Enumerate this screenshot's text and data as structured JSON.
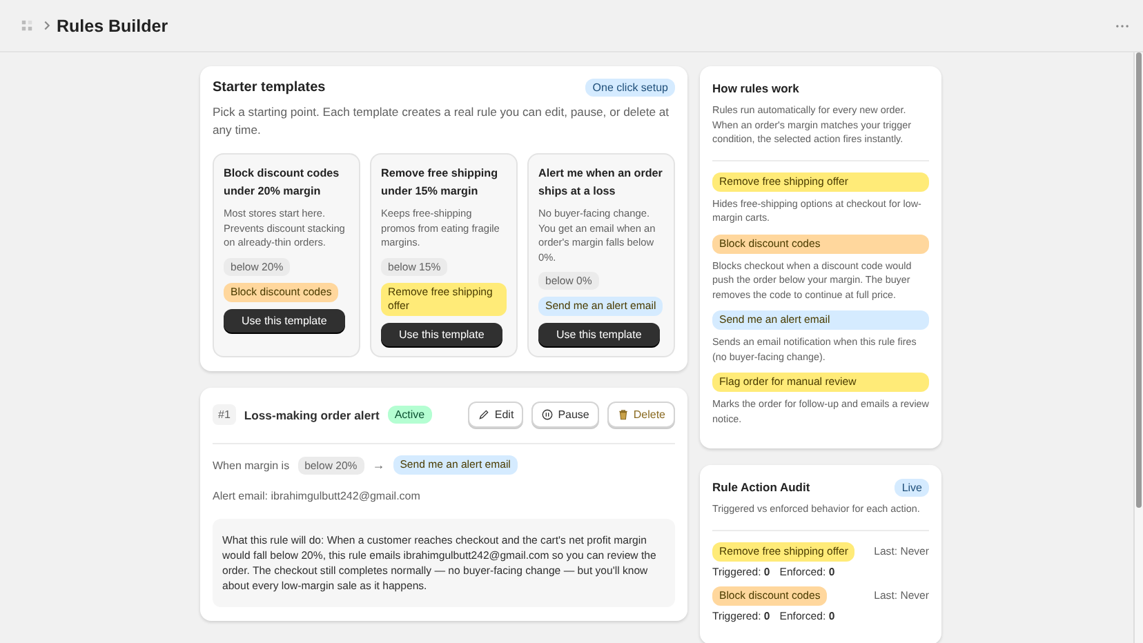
{
  "header": {
    "title": "Rules Builder"
  },
  "starter": {
    "title": "Starter templates",
    "badge": "One click setup",
    "description": "Pick a starting point. Each template creates a real rule you can edit, pause, or delete at any time.",
    "templates": [
      {
        "title": "Block discount codes under 20% margin",
        "description": "Most stores start here. Prevents discount stacking on already-thin orders.",
        "condition": "below 20%",
        "action": {
          "text": "Block discount codes",
          "color": "#ffd79d"
        },
        "button": "Use this template"
      },
      {
        "title": "Remove free shipping under 15% margin",
        "description": "Keeps free-shipping promos from eating fragile margins.",
        "condition": "below 15%",
        "action": {
          "text": "Remove free shipping offer",
          "color": "#ffeb78"
        },
        "button": "Use this template"
      },
      {
        "title": "Alert me when an order ships at a loss",
        "description": "No buyer-facing change. You get an email when an order's margin falls below 0%.",
        "condition": "below 0%",
        "action": {
          "text": "Send me an alert email",
          "color": "#d5ebff"
        },
        "button": "Use this template"
      }
    ]
  },
  "rule": {
    "number": "#1",
    "name": "Loss-making order alert",
    "status": "Active",
    "active": true,
    "buttons": [
      {
        "label": "Edit",
        "kind": "edit"
      },
      {
        "label": "Pause",
        "kind": "pause"
      },
      {
        "label": "Delete",
        "kind": "delete"
      }
    ],
    "condition_label": "When margin is",
    "condition": "below 20%",
    "arrow": "→",
    "action": {
      "text": "Send me an alert email",
      "color": "#d5ebff"
    },
    "email_line": "Alert email: ibrahimgulbutt242@gmail.com",
    "explanation": "What this rule will do: When a customer reaches checkout and the cart's net profit margin would fall below 20%, this rule emails ibrahimgulbutt242@gmail.com so you can review the order. The checkout still completes normally — no buyer-facing change — but you'll know about every low-margin sale as it happens."
  },
  "how_rules_work": {
    "title": "How rules work",
    "description": "Rules run automatically for every new order. When an order's margin matches your trigger condition, the selected action fires instantly.",
    "actions": [
      {
        "text": "Remove free shipping offer",
        "color": "#ffeb78",
        "description": "Hides free-shipping options at checkout for low-margin carts."
      },
      {
        "text": "Block discount codes",
        "color": "#ffd79d",
        "description": "Blocks checkout when a discount code would push the order below your margin. The buyer removes the code to continue at full price."
      },
      {
        "text": "Send me an alert email",
        "color": "#d5ebff",
        "description": "Sends an email notification when this rule fires (no buyer-facing change)."
      },
      {
        "text": "Flag order for manual review",
        "color": "#ffeb78",
        "description": "Marks the order for follow-up and emails a review notice."
      }
    ]
  },
  "audit": {
    "title": "Rule Action Audit",
    "badge": "Live",
    "description": "Triggered vs enforced behavior for each action.",
    "rows": [
      {
        "action": {
          "text": "Remove free shipping offer",
          "color": "#ffeb78"
        },
        "last": "Last: Never",
        "triggered": "Triggered: **0**",
        "enforced": "Enforced: **0**"
      },
      {
        "action": {
          "text": "Block discount codes",
          "color": "#ffd79d"
        },
        "last": "Last: Never",
        "triggered": "Triggered: **0**",
        "enforced": "Enforced: **0**"
      }
    ]
  }
}
